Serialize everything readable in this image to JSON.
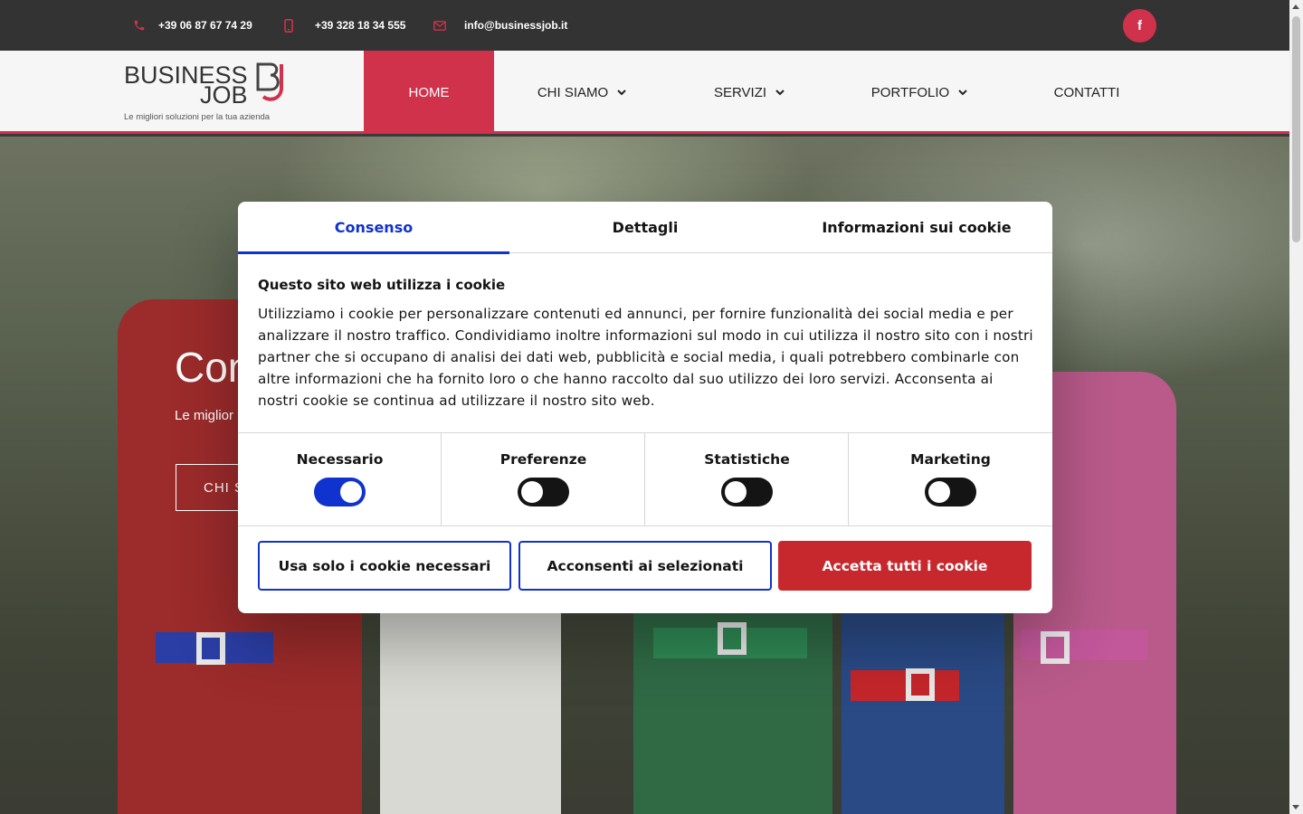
{
  "topbar": {
    "phone": "+39 06 87 67 74 29",
    "mobile": "+39 328 18 34 555",
    "email": "info@businessjob.it",
    "facebook_label": "f"
  },
  "logo": {
    "word1": "BUSINESS",
    "word2": "JOB",
    "tagline": "Le migliori soluzioni per la tua azienda"
  },
  "nav": {
    "home": "HOME",
    "chi_siamo": "CHI SIAMO",
    "servizi": "SERVIZI",
    "portfolio": "PORTFOLIO",
    "contatti": "CONTATTI"
  },
  "hero": {
    "title": "Con",
    "subtitle": "Le miglior",
    "button": "CHI S"
  },
  "cookie": {
    "tabs": [
      "Consenso",
      "Dettagli",
      "Informazioni sui cookie"
    ],
    "title": "Questo sito web utilizza i cookie",
    "text": "Utilizziamo i cookie per personalizzare contenuti ed annunci, per fornire funzionalità dei social media e per analizzare il nostro traffico. Condividiamo inoltre informazioni sul modo in cui utilizza il nostro sito con i nostri partner che si occupano di analisi dei dati web, pubblicità e social media, i quali potrebbero combinarle con altre informazioni che ha fornito loro o che hanno raccolto dal suo utilizzo dei loro servizi. Acconsenta ai nostri cookie se continua ad utilizzare il nostro sito web.",
    "categories": [
      {
        "label": "Necessario",
        "on": true
      },
      {
        "label": "Preferenze",
        "on": false
      },
      {
        "label": "Statistiche",
        "on": false
      },
      {
        "label": "Marketing",
        "on": false
      }
    ],
    "buttons": {
      "necessary": "Usa solo i cookie necessari",
      "selected": "Acconsenti ai selezionati",
      "all": "Accetta tutti i cookie"
    }
  },
  "colors": {
    "accent": "#d0314b",
    "cookie_blue": "#1032cf",
    "cookie_red": "#c6282d",
    "topbar_bg": "#333333"
  }
}
